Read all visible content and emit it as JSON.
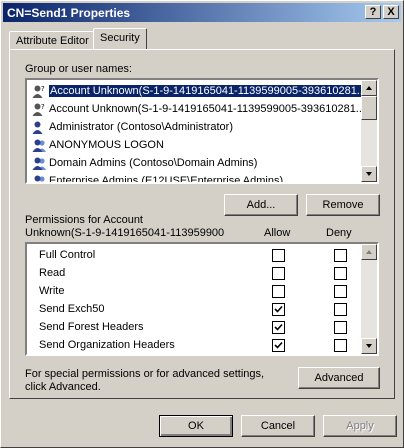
{
  "window": {
    "title": "CN=Send1 Properties",
    "help_btn": "?",
    "close_btn": "X"
  },
  "tabs": [
    {
      "label": "Attribute Editor",
      "active": false
    },
    {
      "label": "Security",
      "active": true
    }
  ],
  "users": {
    "label": "Group or user names:",
    "items": [
      {
        "name": "Account Unknown(S-1-9-1419165041-1139599005-393610281...",
        "icon": "unknown-user-icon",
        "selected": true
      },
      {
        "name": "Account Unknown(S-1-9-1419165041-1139599005-393610281...",
        "icon": "unknown-user-icon",
        "selected": false
      },
      {
        "name": "Administrator (Contoso\\Administrator)",
        "icon": "user-icon",
        "selected": false
      },
      {
        "name": "ANONYMOUS LOGON",
        "icon": "group-icon",
        "selected": false
      },
      {
        "name": "Domain Admins (Contoso\\Domain Admins)",
        "icon": "group-icon",
        "selected": false
      },
      {
        "name": "Enterprise Admins (E12USE\\Enterprise Admins)",
        "icon": "group-icon",
        "selected": false
      }
    ]
  },
  "buttons": {
    "add": "Add...",
    "remove": "Remove",
    "advanced": "Advanced",
    "ok": "OK",
    "cancel": "Cancel",
    "apply": "Apply"
  },
  "permissions": {
    "label_line1": "Permissions for Account",
    "label_line2": "Unknown(S-1-9-1419165041-113959900",
    "allow_header": "Allow",
    "deny_header": "Deny",
    "rows": [
      {
        "name": "Full Control",
        "allow": false,
        "deny": false
      },
      {
        "name": "Read",
        "allow": false,
        "deny": false
      },
      {
        "name": "Write",
        "allow": false,
        "deny": false
      },
      {
        "name": "Send Exch50",
        "allow": true,
        "deny": false
      },
      {
        "name": "Send Forest Headers",
        "allow": true,
        "deny": false
      },
      {
        "name": "Send Organization Headers",
        "allow": true,
        "deny": false
      }
    ]
  },
  "special_note_line1": "For special permissions or for advanced settings,",
  "special_note_line2": "click Advanced."
}
